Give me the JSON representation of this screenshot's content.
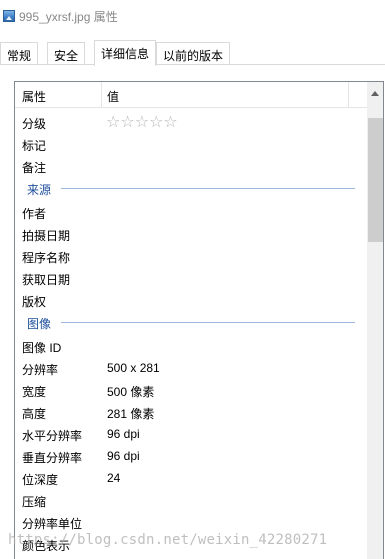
{
  "window": {
    "title": "995_yxrsf.jpg 属性"
  },
  "tabs": [
    {
      "label": "常规"
    },
    {
      "label": "安全"
    },
    {
      "label": "详细信息"
    },
    {
      "label": "以前的版本"
    }
  ],
  "active_tab": "详细信息",
  "table": {
    "header_property": "属性",
    "header_value": "值",
    "rating_stars": "☆☆☆☆☆",
    "rows": [
      {
        "name": "分级",
        "value": ""
      },
      {
        "name": "标记",
        "value": ""
      },
      {
        "name": "备注",
        "value": ""
      },
      {
        "section": "来源"
      },
      {
        "name": "作者",
        "value": ""
      },
      {
        "name": "拍摄日期",
        "value": ""
      },
      {
        "name": "程序名称",
        "value": ""
      },
      {
        "name": "获取日期",
        "value": ""
      },
      {
        "name": "版权",
        "value": ""
      },
      {
        "section": "图像"
      },
      {
        "name": "图像 ID",
        "value": ""
      },
      {
        "name": "分辨率",
        "value": "500 x 281"
      },
      {
        "name": "宽度",
        "value": "500 像素"
      },
      {
        "name": "高度",
        "value": "281 像素"
      },
      {
        "name": "水平分辨率",
        "value": "96 dpi"
      },
      {
        "name": "垂直分辨率",
        "value": "96 dpi"
      },
      {
        "name": "位深度",
        "value": "24"
      },
      {
        "name": "压缩",
        "value": ""
      },
      {
        "name": "分辨率单位",
        "value": ""
      },
      {
        "name": "颜色表示",
        "value": ""
      }
    ]
  },
  "watermark": "https://blog.csdn.net/weixin_42280271",
  "colors": {
    "section_label": "#1e4e9c",
    "section_line": "#9db5d8",
    "star": "#b5b5b5",
    "scroll_thumb": "#cdcdcd"
  },
  "icons": {
    "title": "image-file-icon",
    "rating": "star-outline-icon",
    "scroll_up": "chevron-up-icon"
  }
}
